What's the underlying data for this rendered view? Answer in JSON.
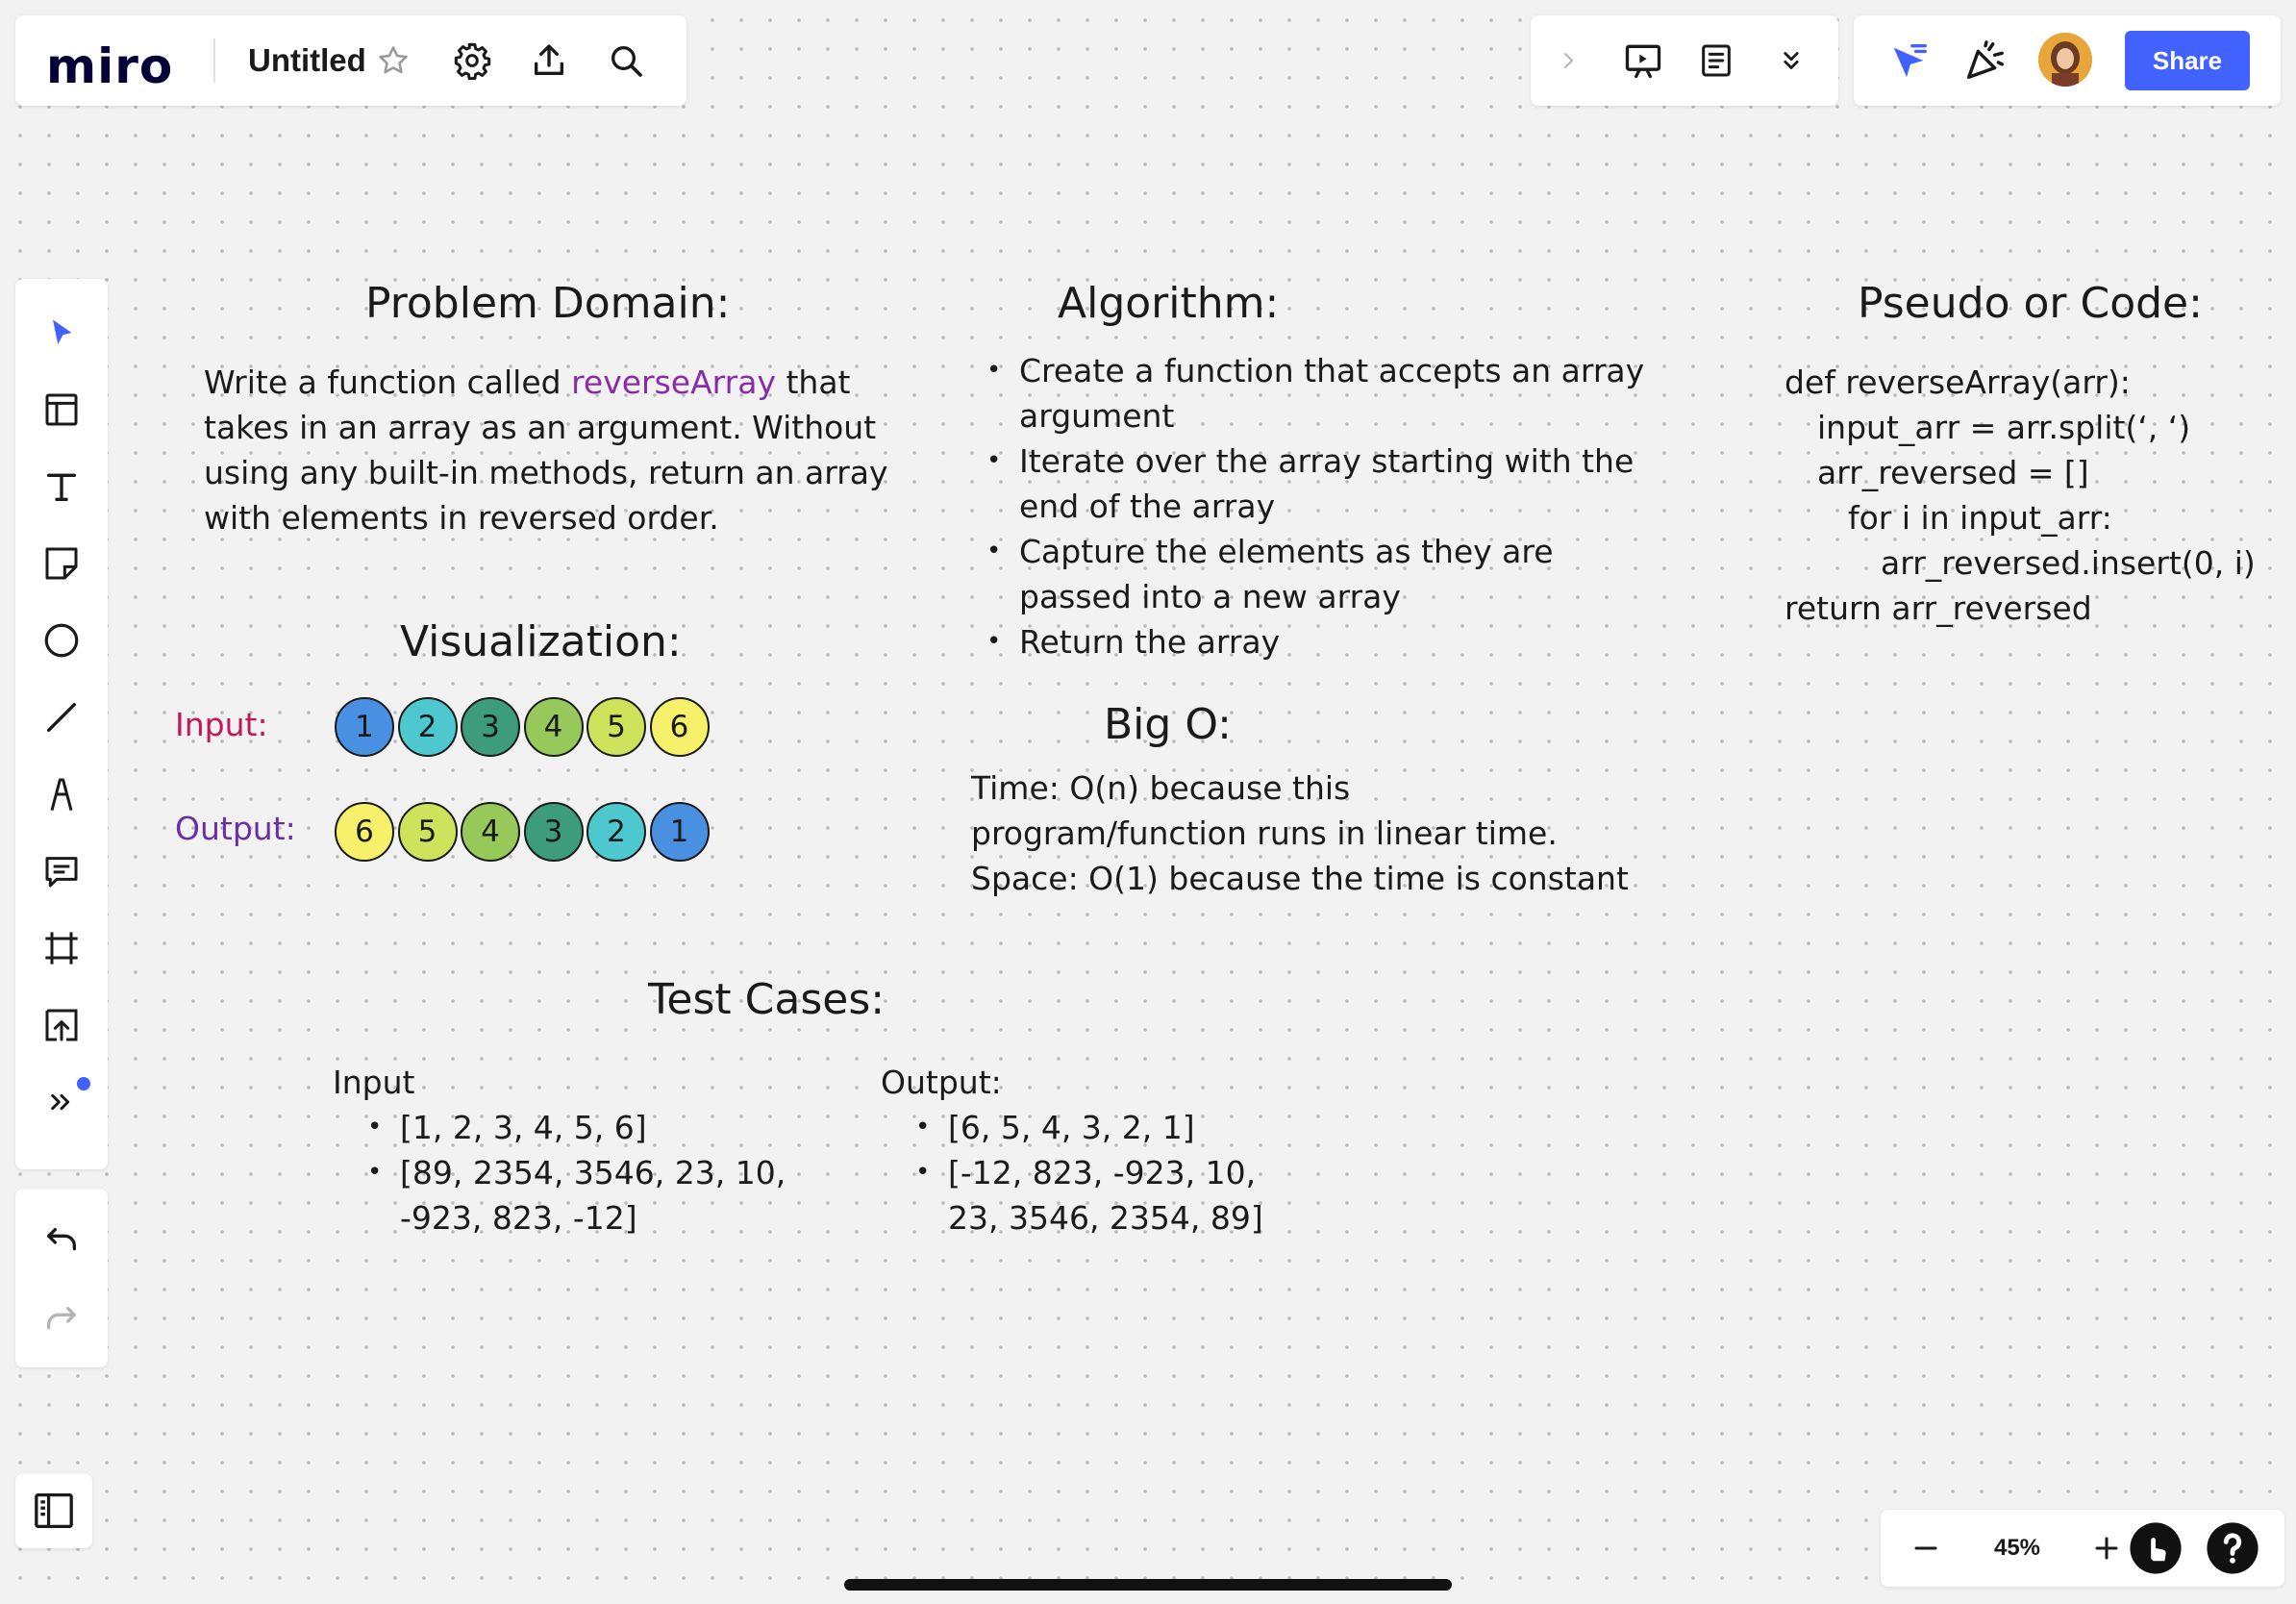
{
  "topbar": {
    "logo": "miro",
    "board_title": "Untitled",
    "share_label": "Share"
  },
  "zoom": {
    "level": "45%"
  },
  "board": {
    "problem_domain": {
      "heading": "Problem Domain:",
      "text_before": "Write a function called ",
      "keyword": "reverseArray",
      "text_after": " that takes in an array as an argument. Without using any built-in methods, return an array with elements in reversed order."
    },
    "algorithm": {
      "heading": "Algorithm:",
      "steps": [
        "Create a function that accepts an array argument",
        "Iterate over the array starting with the end of the array",
        "Capture the elements as they are passed into a new array",
        "Return the array"
      ]
    },
    "pseudo_code": {
      "heading": "Pseudo or Code:",
      "lines": [
        "def reverseArray(arr):",
        "input_arr = arr.split(‘, ‘)",
        "arr_reversed = []",
        "for i in input_arr:",
        "arr_reversed.insert(0, i)",
        "return arr_reversed"
      ]
    },
    "visualization": {
      "heading": "Visualization:",
      "input_label": "Input:",
      "output_label": "Output:",
      "input_values": [
        "1",
        "2",
        "3",
        "4",
        "5",
        "6"
      ],
      "output_values": [
        "6",
        "5",
        "4",
        "3",
        "2",
        "1"
      ],
      "value_colors": {
        "1": "#4a90e2",
        "2": "#4ec8cf",
        "3": "#3d9c7c",
        "4": "#96c95a",
        "5": "#cfe25b",
        "6": "#f7f06b"
      },
      "input_label_color": "#c2185b",
      "output_label_color": "#6a2fa5"
    },
    "big_o": {
      "heading": "Big O:",
      "time": "Time: O(n) because this program/function runs in linear time.",
      "space": "Space: O(1) because the time is constant"
    },
    "test_cases": {
      "heading": "Test Cases:",
      "input_heading": "Input",
      "output_heading": "Output:",
      "inputs": [
        "[1, 2, 3, 4, 5, 6]",
        "[89, 2354, 3546, 23, 10, -923, 823, -12]"
      ],
      "outputs": [
        "[6, 5, 4, 3, 2, 1]",
        "[-12, 823, -923, 10, 23, 3546, 2354, 89]"
      ]
    }
  }
}
